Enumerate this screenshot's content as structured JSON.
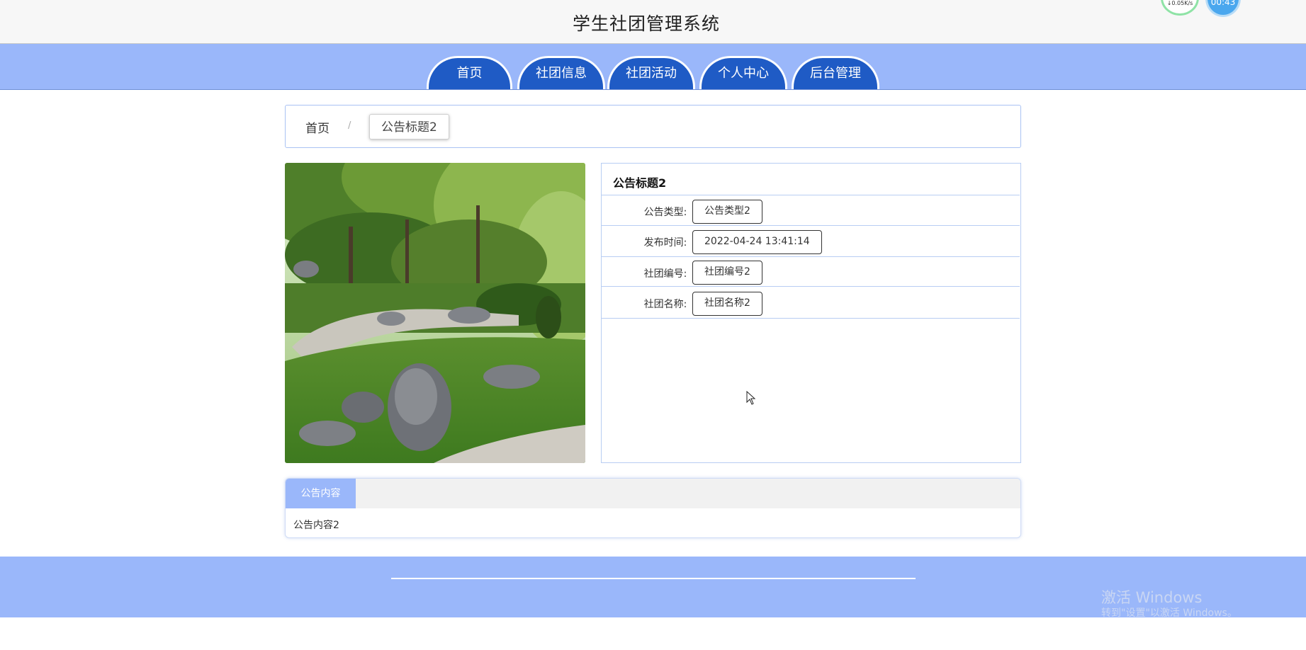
{
  "header": {
    "title": "学生社团管理系统",
    "net_speed": "↓0.05K/s",
    "timer": "00:43"
  },
  "nav": {
    "items": [
      {
        "label": "首页"
      },
      {
        "label": "社团信息"
      },
      {
        "label": "社团活动"
      },
      {
        "label": "个人中心"
      },
      {
        "label": "后台管理"
      }
    ]
  },
  "breadcrumb": {
    "home": "首页",
    "separator": "/",
    "current": "公告标题2"
  },
  "detail": {
    "title": "公告标题2",
    "fields": [
      {
        "label": "公告类型:",
        "value": "公告类型2"
      },
      {
        "label": "发布时间:",
        "value": "2022-04-24 13:41:14"
      },
      {
        "label": "社团编号:",
        "value": "社团编号2"
      },
      {
        "label": "社团名称:",
        "value": "社团名称2"
      }
    ]
  },
  "content": {
    "tab_label": "公告内容",
    "text": "公告内容2"
  },
  "watermark": {
    "line1": "激活 Windows",
    "line2": "转到\"设置\"以激活 Windows。"
  },
  "colors": {
    "nav_bar": "#9ab7fa",
    "nav_tab": "#1f5bc5",
    "border_accent": "#b8cdf3"
  }
}
